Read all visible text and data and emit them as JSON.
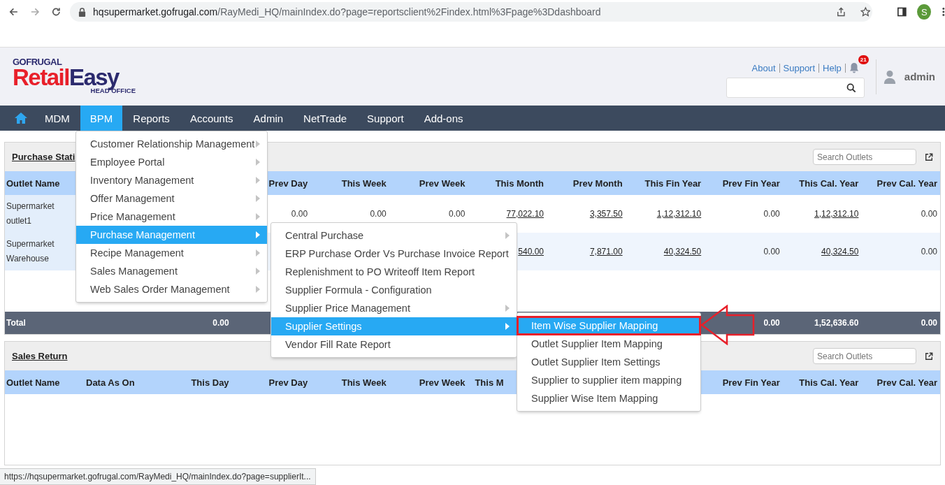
{
  "browser": {
    "url_domain": "hqsupermarket.gofrugal.com",
    "url_path": "/RayMedi_HQ/mainIndex.do?page=reportsclient%2Findex.html%3Fpage%3Ddashboard",
    "profile_initial": "S"
  },
  "header": {
    "logo": {
      "brand": "GOFRUGAL",
      "name_part1": "Retail",
      "name_part2": "Easy",
      "subtitle": "HEAD OFFICE"
    },
    "links": [
      "About",
      "Support",
      "Help"
    ],
    "notification_count": "21",
    "user": "admin"
  },
  "nav": [
    {
      "label": "MDM",
      "selected": false
    },
    {
      "label": "BPM",
      "selected": true
    },
    {
      "label": "Reports",
      "selected": false
    },
    {
      "label": "Accounts",
      "selected": false
    },
    {
      "label": "Admin",
      "selected": false
    },
    {
      "label": "NetTrade",
      "selected": false
    },
    {
      "label": "Support",
      "selected": false
    },
    {
      "label": "Add-ons",
      "selected": false
    }
  ],
  "panels": [
    {
      "title": "Purchase Stati",
      "search": {
        "placeholder": "Search Outlets"
      },
      "columns": [
        "Outlet Name",
        null,
        null,
        "Prev Day",
        "This Week",
        "Prev Week",
        "This Month",
        "Prev Month",
        "This Fin Year",
        "Prev Fin Year",
        "This Cal. Year",
        "Prev Cal. Year"
      ],
      "rows": [
        {
          "cells": [
            {
              "text": "Supermarket outlet1",
              "link": false
            },
            null,
            null,
            {
              "text": "0.00",
              "link": false
            },
            {
              "text": "0.00",
              "link": false
            },
            {
              "text": "0.00",
              "link": false
            },
            {
              "text": "77,022.10",
              "link": true
            },
            {
              "text": "3,357.50",
              "link": true
            },
            {
              "text": "1,12,312.10",
              "link": true
            },
            {
              "text": "0.00",
              "link": false
            },
            {
              "text": "1,12,312.10",
              "link": true
            },
            {
              "text": "0.00",
              "link": false
            }
          ]
        },
        {
          "cells": [
            {
              "text": "Supermarket Warehouse",
              "link": false
            },
            null,
            null,
            null,
            null,
            null,
            {
              "text": "540.00",
              "link": true
            },
            {
              "text": "7,871.00",
              "link": true
            },
            {
              "text": "40,324.50",
              "link": true
            },
            {
              "text": "0.00",
              "link": false
            },
            {
              "text": "40,324.50",
              "link": true
            },
            {
              "text": "0.00",
              "link": false
            }
          ]
        }
      ],
      "total": {
        "outlet_name": "Total",
        "this_day": "0.00",
        "prev_fin_year": "0.00",
        "this_cal_year": "1,52,636.60",
        "prev_cal_year": "0.00"
      }
    },
    {
      "title": "Sales Return",
      "search": {
        "placeholder": "Search Outlets"
      },
      "columns": [
        "Outlet Name",
        "Data As On",
        "This Day",
        "Prev Day",
        "This Week",
        "Prev Week",
        "This M",
        null,
        null,
        "Prev Fin Year",
        "This Cal. Year",
        "Prev Cal. Year"
      ]
    }
  ],
  "menus": [
    {
      "items": [
        {
          "label": "Customer Relationship Management",
          "submenu": true,
          "selected": false
        },
        {
          "label": "Employee Portal",
          "submenu": true,
          "selected": false
        },
        {
          "label": "Inventory Management",
          "submenu": true,
          "selected": false
        },
        {
          "label": "Offer Management",
          "submenu": true,
          "selected": false
        },
        {
          "label": "Price Management",
          "submenu": true,
          "selected": false
        },
        {
          "label": "Purchase Management",
          "submenu": true,
          "selected": true
        },
        {
          "label": "Recipe Management",
          "submenu": true,
          "selected": false
        },
        {
          "label": "Sales Management",
          "submenu": true,
          "selected": false
        },
        {
          "label": "Web Sales Order Management",
          "submenu": true,
          "selected": false
        }
      ]
    },
    {
      "items": [
        {
          "label": "Central Purchase",
          "submenu": true,
          "selected": false
        },
        {
          "label": "ERP Purchase Order Vs Purchase Invoice Report",
          "submenu": false,
          "selected": false
        },
        {
          "label": "Replenishment to PO Writeoff Item Report",
          "submenu": false,
          "selected": false
        },
        {
          "label": "Supplier Formula - Configuration",
          "submenu": false,
          "selected": false
        },
        {
          "label": "Supplier Price Management",
          "submenu": true,
          "selected": false
        },
        {
          "label": "Supplier Settings",
          "submenu": true,
          "selected": true
        },
        {
          "label": "Vendor Fill Rate Report",
          "submenu": false,
          "selected": false
        }
      ]
    },
    {
      "items": [
        {
          "label": "Item Wise Supplier Mapping",
          "submenu": false,
          "selected": true,
          "highlighted": true
        },
        {
          "label": "Outlet Supplier Item Mapping",
          "submenu": false,
          "selected": false,
          "highlighted": false
        },
        {
          "label": "Outlet Supplier Item Settings",
          "submenu": false,
          "selected": false,
          "highlighted": false
        },
        {
          "label": "Supplier to supplier item mapping",
          "submenu": false,
          "selected": false,
          "highlighted": false
        },
        {
          "label": "Supplier Wise Item Mapping",
          "submenu": false,
          "selected": false,
          "highlighted": false
        }
      ]
    }
  ],
  "status_bar": "https://hqsupermarket.gofrugal.com/RayMedi_HQ/mainIndex.do?page=supplierIt..."
}
